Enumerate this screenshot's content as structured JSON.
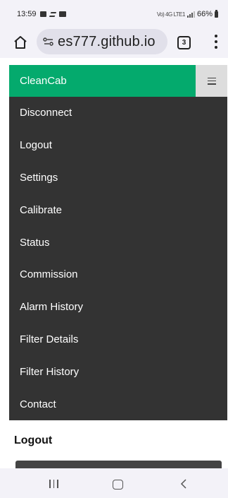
{
  "status_bar": {
    "time": "13:59",
    "battery": "66%",
    "network": "Vo) 4G LTE1"
  },
  "browser": {
    "url": "es777.github.io",
    "tab_count": "3"
  },
  "navbar": {
    "brand": "CleanCab",
    "accent_color": "#04aa6d"
  },
  "menu": {
    "items": [
      {
        "label": "Disconnect"
      },
      {
        "label": "Logout"
      },
      {
        "label": "Settings"
      },
      {
        "label": "Calibrate"
      },
      {
        "label": "Status"
      },
      {
        "label": "Commission"
      },
      {
        "label": "Alarm History"
      },
      {
        "label": "Filter Details"
      },
      {
        "label": "Filter History"
      },
      {
        "label": "Contact"
      }
    ]
  },
  "content": {
    "heading": "Logout"
  }
}
